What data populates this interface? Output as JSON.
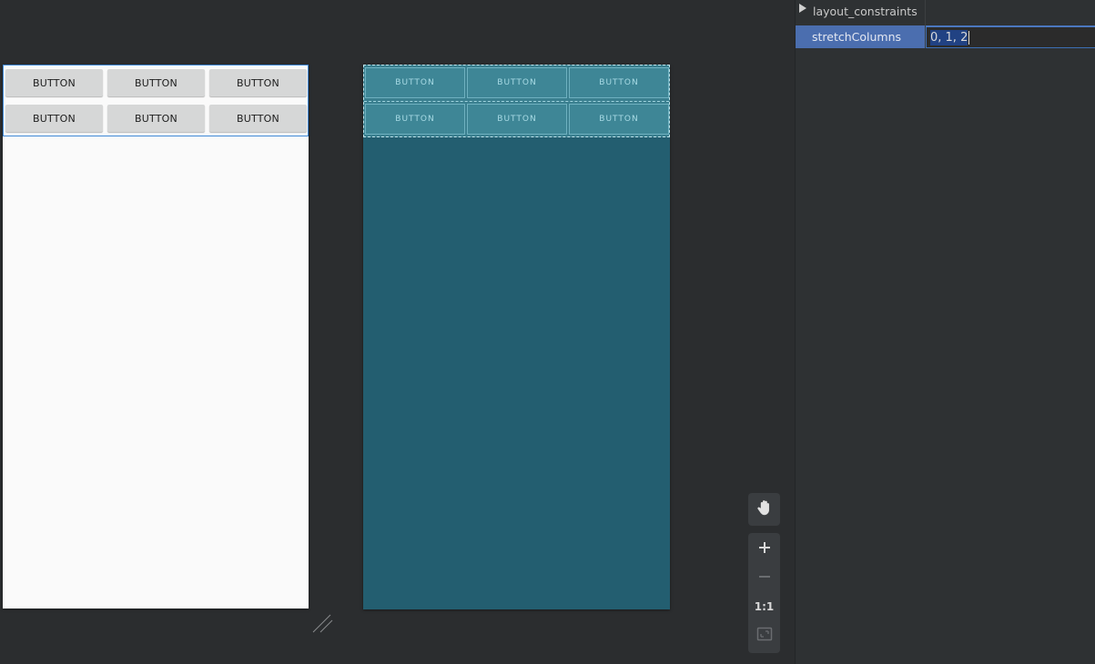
{
  "design_preview": {
    "rows": [
      {
        "buttons": [
          "BUTTON",
          "BUTTON",
          "BUTTON"
        ]
      },
      {
        "buttons": [
          "BUTTON",
          "BUTTON",
          "BUTTON"
        ]
      }
    ]
  },
  "blueprint_preview": {
    "rows": [
      {
        "buttons": [
          "BUTTON",
          "BUTTON",
          "BUTTON"
        ]
      },
      {
        "buttons": [
          "BUTTON",
          "BUTTON",
          "BUTTON"
        ]
      }
    ]
  },
  "zoom_toolbar": {
    "pan_icon": "hand-icon",
    "zoom_in_icon": "plus-icon",
    "zoom_out_icon": "minus-icon",
    "reset_label": "1:1",
    "fit_icon": "fit-screen-icon"
  },
  "attributes": {
    "rows": [
      {
        "name": "layout_constraints",
        "expandable": true
      },
      {
        "name": "stretchColumns",
        "value": "0, 1, 2",
        "selected": true
      }
    ]
  },
  "colors": {
    "blueprint_bg": "#235e70",
    "selection_accent": "#4b6eaf",
    "design_button": "#d6d7d7",
    "canvas_bg": "#2b2d2f"
  }
}
